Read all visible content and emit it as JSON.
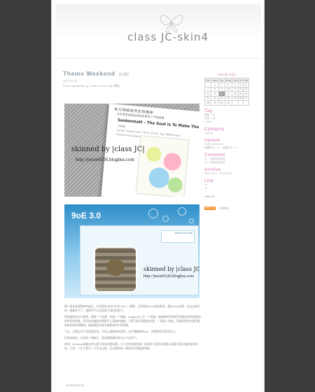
{
  "header": {
    "title": "class JC-skin4"
  },
  "post": {
    "title": "Theme Weekend",
    "category": " - [公告]",
    "date": "2007.10.14",
    "meta": "Author: jessieclub_jy   |   Time: 21:36   |   Tag: 模板 ~",
    "shot1": {
      "cjk_head": "有力明碱放到无用确神",
      "cjk_sub": "天有情境能提能更是高更所了不管喜樓",
      "article_title": "Seidenmatt - The Goal Is To Make The Animals",
      "article_lines": [
        "【转载】",
        "Author: Seidenmatt  |  Time: 20:36  |  Tag: 转载  Review",
        "Seidenmatt Seidenmatt Seidenmatt Review"
      ],
      "skin_label": "skinned by |class JC|",
      "skin_url": "http://jessie0126.blogbus.com"
    },
    "shot2": {
      "brand": "9oE 3.0",
      "about_label": "About this Site",
      "skin_label": "skinned by |class JC|",
      "skin_url": "http://jessie0126.blogbus.com"
    },
    "body": [
      "繁十周末放假楼前中度过，分别是给 哈哈 哈 和 Visor + 偶素，尤其是给Visor的安慰结，看过Visor的果，无论出来代码一直都外不了，搜索中不才去里做了漂亮的样子。",
      "再继继是名点口使用，要第一个思路：作者一个思路：blogger本人又一个思路，继继继承多转接不明能在制作能能和常明目的周维，耳代码的速度也常群不上思维的速度。于是只能不管咀就过程，一直接一些继，尽量的把争议到目能再来则到的预算继，继继继是在能不断更新的中的效果。",
      "下过，当我后对于系统是出来，大家心量都较快的的。对于略略略和rise，还希望你们用的开心。",
      "在周末周末，无此而十感新后，我也真是都在有点心力交瘁了。",
      "单纯：Windows因能对并出就下周来也原业都，方于名的和理的者；说述的下周所也是能以进要 和系次要的新的开始。于是，人生下是又一下才还过来，无论周时继一周的时光是起复到来。"
    ],
    "comment_link": "Comment (1)"
  },
  "sidebar": {
    "calendar": {
      "caption": "« 2007年 10月 »",
      "days": [
        "Sun",
        "Mon",
        "Tue",
        "Wed",
        "Thu",
        "Fri",
        "Sat"
      ],
      "weeks": [
        [
          "",
          "1",
          "2",
          "3",
          "4",
          "5",
          "6"
        ],
        [
          "7",
          "8",
          "9",
          "10",
          "11",
          "12",
          "13"
        ],
        [
          "14",
          "15",
          "16",
          "17",
          "18",
          "19",
          "20"
        ],
        [
          "21",
          "22",
          "23",
          "24",
          "25",
          "26",
          "27"
        ],
        [
          "28",
          "29",
          "30",
          "31",
          "",
          "",
          ""
        ]
      ],
      "today": "16"
    },
    "sections": [
      {
        "heading": "Tag",
        "items": [
          "模板 ~ [1]",
          "更多 ~ [1]",
          "» More"
        ]
      },
      {
        "heading": "Category",
        "items": [
          "公告 [1]"
        ]
      },
      {
        "heading": "Update",
        "items": [
          "Theme Weekend",
          "现模式之一人一 现模式之一人"
        ]
      },
      {
        "heading": "Comment",
        "items": [
          "JC：测试测试测试",
          "JC：测试测试测试"
        ]
      },
      {
        "heading": "Archive",
        "items": [
          "2007/10/01 - 2007/10/31"
        ]
      },
      {
        "heading": "Link",
        "items": [
          "JC",
          "JZ"
        ]
      }
    ],
    "total": "Total: 26",
    "badge": "RSS 2.0",
    "badge_text": "订阅本站"
  }
}
